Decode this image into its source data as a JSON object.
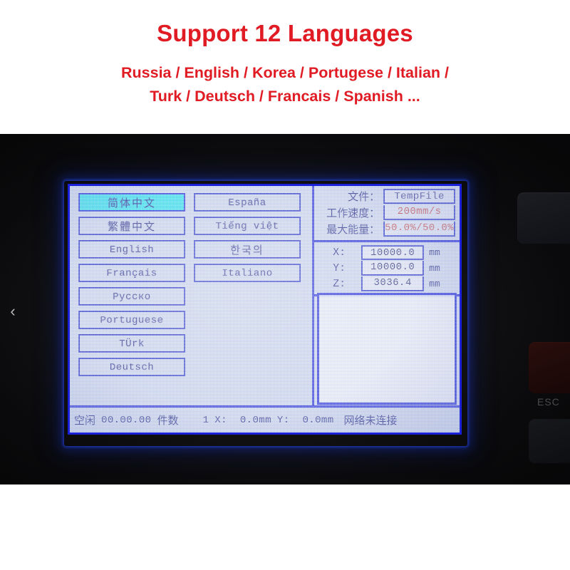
{
  "banner": {
    "title": "Support 12 Languages",
    "subtitle_line1": "Russia / English / Korea / Portugese / Italian /",
    "subtitle_line2": "Turk / Deutsch / Francais / Spanish ..."
  },
  "colors": {
    "banner_text": "#e01b24",
    "lcd_background": "#cfd8ee",
    "lcd_border": "#1a21d8",
    "selected_highlight": "#22e4ef",
    "text_blue": "#2b2f86",
    "value_red": "#c2413f"
  },
  "photo": {
    "nav_prev_icon": "chevron-left-icon",
    "nav_prev_label": "‹",
    "bezel_esc_label": "ESC"
  },
  "lcd": {
    "languages": {
      "column_left": [
        {
          "label": "简体中文",
          "script": "cjk",
          "selected": true
        },
        {
          "label": "繁體中文",
          "script": "cjk",
          "selected": false
        },
        {
          "label": "English",
          "script": "latin",
          "selected": false
        },
        {
          "label": "Français",
          "script": "latin",
          "selected": false
        },
        {
          "label": "Русско",
          "script": "latin",
          "selected": false
        },
        {
          "label": "Portuguese",
          "script": "latin",
          "selected": false
        },
        {
          "label": "TÜrk",
          "script": "latin",
          "selected": false
        },
        {
          "label": "Deutsch",
          "script": "latin",
          "selected": false
        }
      ],
      "column_right": [
        {
          "label": "España",
          "script": "latin",
          "selected": false
        },
        {
          "label": "Tiếng việt",
          "script": "latin",
          "selected": false
        },
        {
          "label": "한국의",
          "script": "cjk",
          "selected": false
        },
        {
          "label": "Italiano",
          "script": "latin",
          "selected": false
        }
      ]
    },
    "info": {
      "file_label": "文件：",
      "file_value": "TempFile",
      "speed_label": "工作速度：",
      "speed_value": "200mm/s",
      "power_label": "最大能量：",
      "power_value": "50.0%/50.0%"
    },
    "coordinates": [
      {
        "axis": "X:",
        "value": "10000.0",
        "unit": "mm"
      },
      {
        "axis": "Y:",
        "value": "10000.0",
        "unit": "mm"
      },
      {
        "axis": "Z:",
        "value": "3036.4",
        "unit": "mm"
      }
    ],
    "status_bar": {
      "state": "空闲",
      "timer": "00.00.00",
      "count_label": "件数",
      "count_value": "1",
      "x_label": "X:",
      "x_value": "0.0mm",
      "y_label": "Y:",
      "y_value": "0.0mm",
      "network": "网络未连接"
    }
  }
}
